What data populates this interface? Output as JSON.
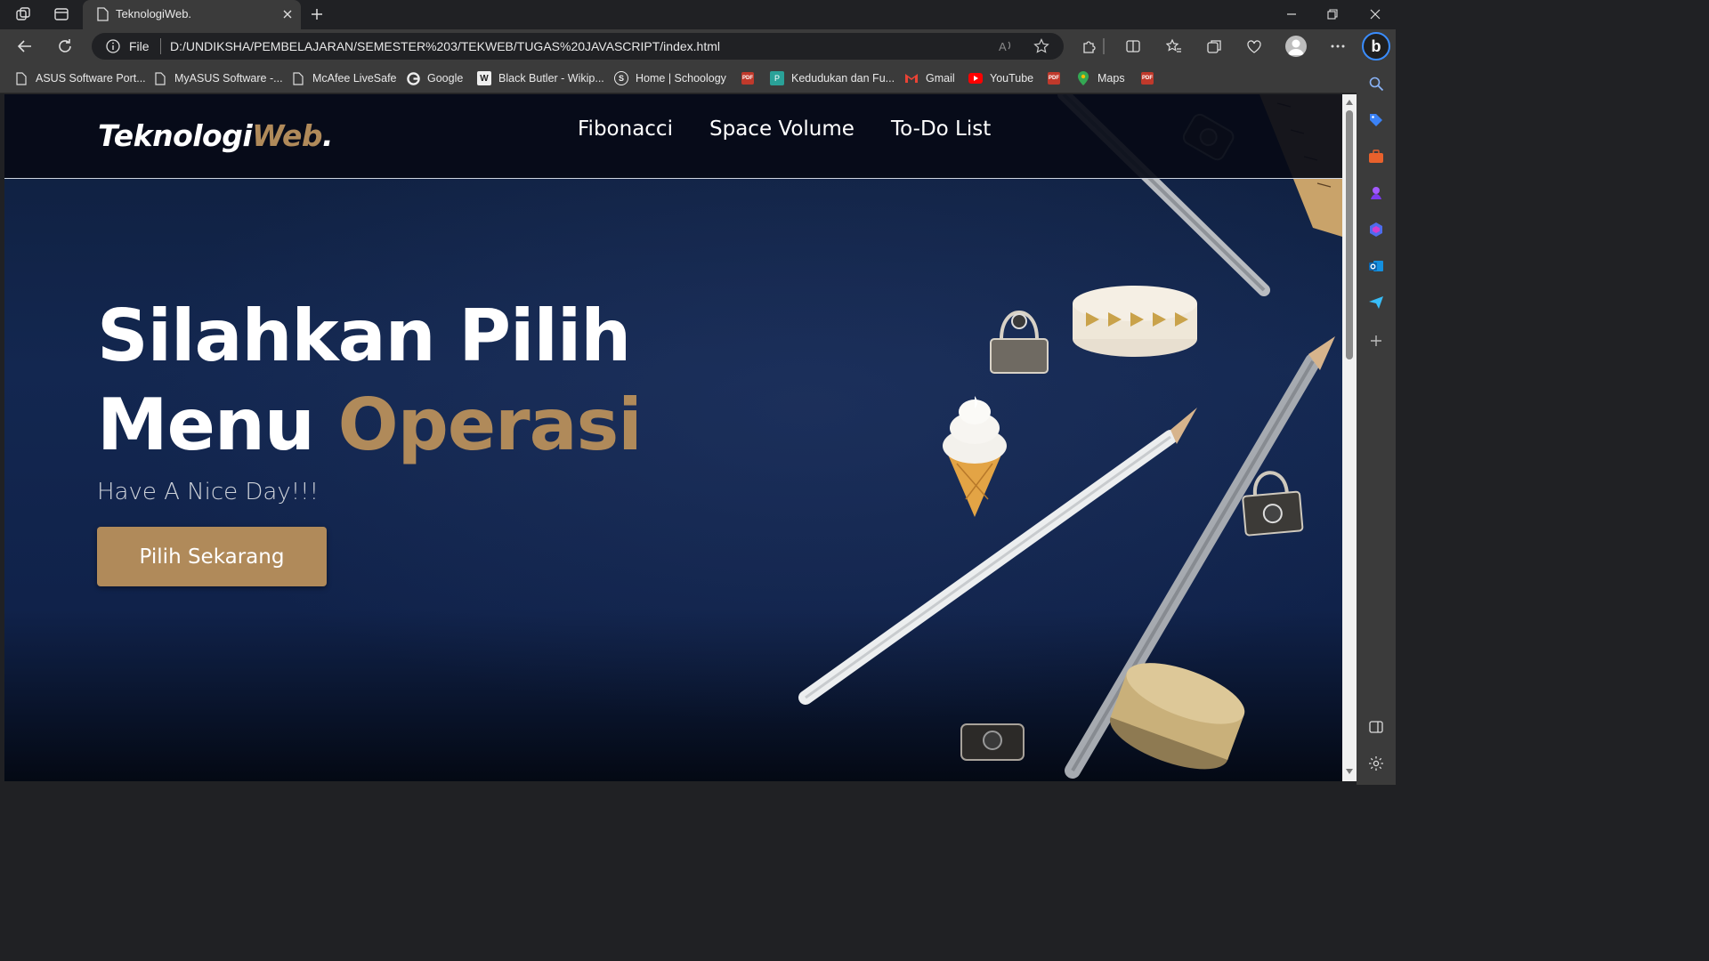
{
  "browser": {
    "tab_title": "TeknologiWeb.",
    "address_scheme": "File",
    "address_url": "D:/UNDIKSHA/PEMBELAJARAN/SEMESTER%203/TEKWEB/TUGAS%20JAVASCRIPT/index.html"
  },
  "bookmarks": [
    {
      "label": "ASUS Software Port...",
      "icon": "page-icon"
    },
    {
      "label": "MyASUS Software -...",
      "icon": "page-icon"
    },
    {
      "label": "McAfee LiveSafe",
      "icon": "page-icon"
    },
    {
      "label": "Google",
      "icon": "google-icon"
    },
    {
      "label": "Black Butler - Wikip...",
      "icon": "wikipedia-icon"
    },
    {
      "label": "Home | Schoology",
      "icon": "schoology-icon"
    },
    {
      "label": "",
      "icon": "pdf-icon"
    },
    {
      "label": "Kedudukan dan Fu...",
      "icon": "site-icon"
    },
    {
      "label": "Gmail",
      "icon": "gmail-icon"
    },
    {
      "label": "YouTube",
      "icon": "youtube-icon"
    },
    {
      "label": "",
      "icon": "pdf-icon"
    },
    {
      "label": "Maps",
      "icon": "maps-icon"
    },
    {
      "label": "",
      "icon": "pdf-icon"
    }
  ],
  "site": {
    "logo_main": "Teknologi",
    "logo_accent": "Web",
    "logo_dot": ".",
    "menu": [
      "Fibonacci",
      "Space Volume",
      "To-Do List"
    ],
    "hero_line1": "Silahkan Pilih",
    "hero_line2_white": "Menu ",
    "hero_line2_accent": "Operasi",
    "hero_subtitle": "Have A Nice Day!!!",
    "cta_label": "Pilih Sekarang"
  },
  "colors": {
    "accent": "#b08a5a",
    "nav_bg": "#060a16",
    "hero_bg": "#132750"
  }
}
